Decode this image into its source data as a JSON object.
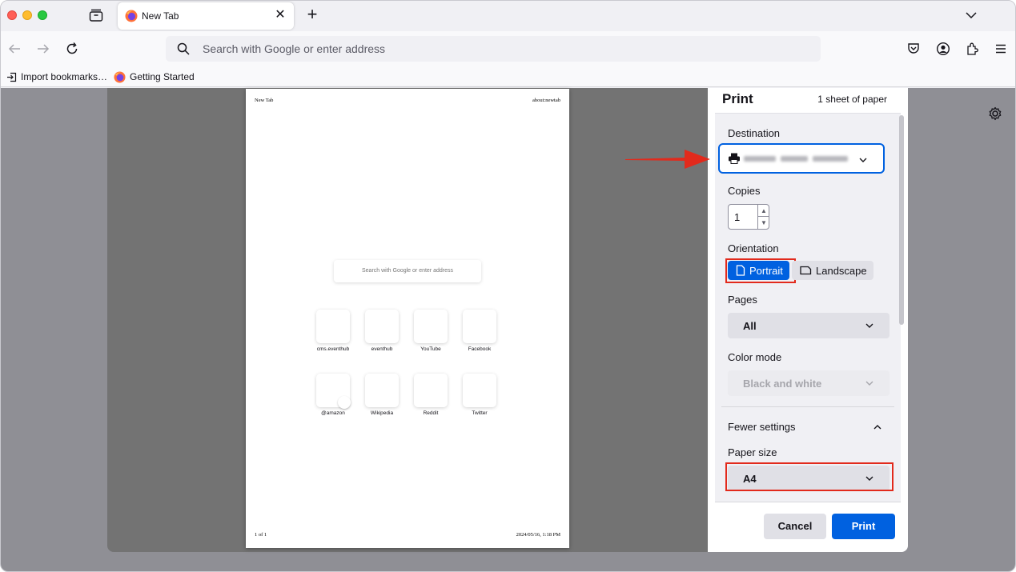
{
  "browser": {
    "tab": {
      "title": "New Tab",
      "close_glyph": "✕"
    },
    "new_tab_glyph": "+",
    "urlbar": {
      "placeholder": "Search with Google or enter address"
    },
    "bookmarks": [
      {
        "label": "Import bookmarks…",
        "icon": "import-icon"
      },
      {
        "label": "Getting Started",
        "icon": "firefox-icon"
      }
    ],
    "toolbar_icons": [
      "back-icon",
      "forward-icon",
      "reload-icon",
      "pocket-icon",
      "account-icon",
      "extensions-icon",
      "menu-icon"
    ]
  },
  "preview": {
    "header_left": "New Tab",
    "header_right": "about:newtab",
    "footer_left": "1 of 1",
    "footer_right": "2024/05/16, 1:18 PM",
    "search_placeholder": "Search with Google or enter address",
    "sites": [
      "cms.eventhub",
      "eventhub",
      "YouTube",
      "Facebook",
      "@amazon",
      "Wikipedia",
      "Reddit",
      "Twitter"
    ]
  },
  "print": {
    "title": "Print",
    "sheets": "1 sheet of paper",
    "destination_label": "Destination",
    "copies_label": "Copies",
    "copies_value": "1",
    "orientation_label": "Orientation",
    "orientation_portrait": "Portrait",
    "orientation_landscape": "Landscape",
    "pages_label": "Pages",
    "pages_value": "All",
    "color_mode_label": "Color mode",
    "color_mode_value": "Black and white",
    "fewer_settings": "Fewer settings",
    "paper_size_label": "Paper size",
    "paper_size_value": "A4",
    "cancel": "Cancel",
    "print": "Print"
  },
  "colors": {
    "accent": "#0061e0",
    "annotation": "#e22a1c"
  }
}
